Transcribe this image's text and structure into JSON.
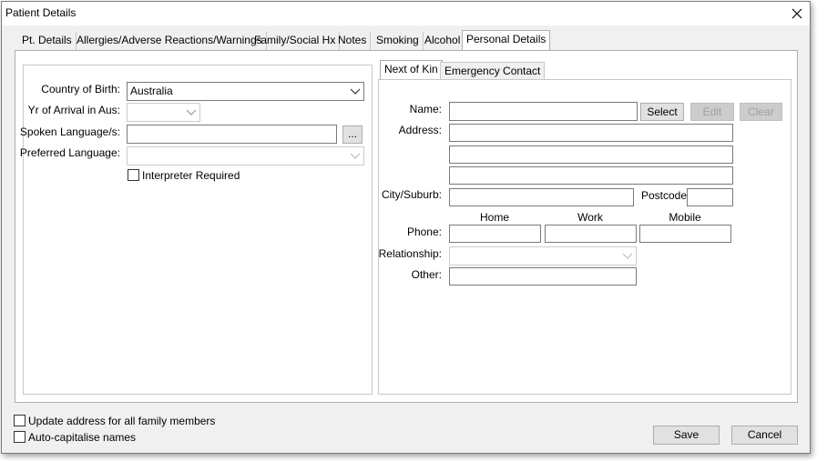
{
  "window": {
    "title": "Patient Details"
  },
  "tabs": [
    {
      "label": "Pt. Details",
      "selected": false
    },
    {
      "label": "Allergies/Adverse Reactions/Warnings",
      "selected": false
    },
    {
      "label": "Family/Social Hx",
      "selected": false
    },
    {
      "label": "Notes",
      "selected": false
    },
    {
      "label": "Smoking",
      "selected": false
    },
    {
      "label": "Alcohol",
      "selected": false
    },
    {
      "label": "Personal Details",
      "selected": true
    }
  ],
  "left": {
    "country_label": "Country of Birth:",
    "country_value": "Australia",
    "arrival_label": "Yr of Arrival in Aus:",
    "arrival_value": "",
    "spoken_label": "Spoken Language/s:",
    "spoken_value": "",
    "spoken_browse_label": "...",
    "preferred_label": "Preferred Language:",
    "preferred_value": "",
    "interpreter_label": "Interpreter Required",
    "interpreter_checked": false
  },
  "right": {
    "subtabs": [
      {
        "label": "Next of Kin",
        "selected": true
      },
      {
        "label": "Emergency Contact",
        "selected": false
      }
    ],
    "name_label": "Name:",
    "name_value": "",
    "select_label": "Select",
    "edit_label": "Edit",
    "clear_label": "Clear",
    "address_label": "Address:",
    "address_lines": [
      "",
      "",
      ""
    ],
    "city_label": "City/Suburb:",
    "city_value": "",
    "postcode_label": "Postcode:",
    "postcode_value": "",
    "phone_label": "Phone:",
    "phone_headers": [
      "Home",
      "Work",
      "Mobile"
    ],
    "phone_values": [
      "",
      "",
      ""
    ],
    "relationship_label": "Relationship:",
    "relationship_value": "",
    "other_label": "Other:",
    "other_value": ""
  },
  "footer": {
    "update_address_label": "Update address for all family members",
    "autocap_label": "Auto-capitalise names",
    "save_label": "Save",
    "cancel_label": "Cancel"
  },
  "colors": {
    "accent": "#0078d7",
    "disabled_text": "#a0a0a0"
  }
}
